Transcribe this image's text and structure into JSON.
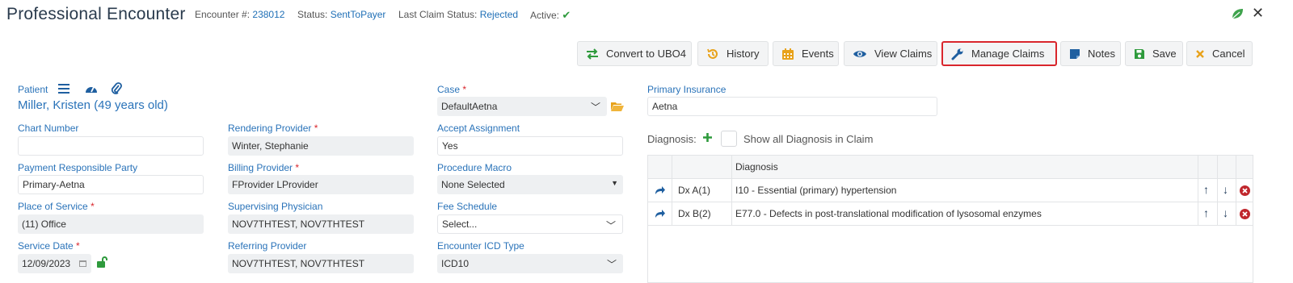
{
  "header": {
    "title": "Professional Encounter",
    "encounter_label": "Encounter #:",
    "encounter_number": "238012",
    "status_label": "Status:",
    "status_value": "SentToPayer",
    "claim_status_label": "Last Claim Status:",
    "claim_status_value": "Rejected",
    "active_label": "Active:",
    "active_icon": "check-icon"
  },
  "toolbar": {
    "convert": "Convert to UBO4",
    "history": "History",
    "events": "Events",
    "view_claims": "View Claims",
    "manage_claims": "Manage Claims",
    "notes": "Notes",
    "save": "Save",
    "cancel": "Cancel"
  },
  "patient": {
    "label": "Patient",
    "name": "Miller, Kristen (49 years old)"
  },
  "fields": {
    "chart_number": {
      "label": "Chart Number",
      "value": ""
    },
    "payment_party": {
      "label": "Payment Responsible Party",
      "value": "Primary-Aetna"
    },
    "place_of_service": {
      "label": "Place of Service",
      "value": "(11) Office"
    },
    "service_date": {
      "label": "Service Date",
      "value": "12/09/2023"
    },
    "rendering_provider": {
      "label": "Rendering Provider",
      "value": "Winter, Stephanie"
    },
    "billing_provider": {
      "label": "Billing Provider",
      "value": "FProvider LProvider"
    },
    "supervising_physician": {
      "label": "Supervising Physician",
      "value": "NOV7THTEST, NOV7THTEST"
    },
    "referring_provider": {
      "label": "Referring Provider",
      "value": "NOV7THTEST, NOV7THTEST"
    },
    "case": {
      "label": "Case",
      "value": "DefaultAetna"
    },
    "accept_assignment": {
      "label": "Accept Assignment",
      "value": "Yes"
    },
    "procedure_macro": {
      "label": "Procedure Macro",
      "value": "None Selected"
    },
    "fee_schedule": {
      "label": "Fee Schedule",
      "value": "Select..."
    },
    "icd_type": {
      "label": "Encounter ICD Type",
      "value": "ICD10"
    },
    "primary_insurance": {
      "label": "Primary Insurance",
      "value": "Aetna"
    }
  },
  "required_mark": "*",
  "diagnosis": {
    "label": "Diagnosis:",
    "show_all_label": "Show all Diagnosis in Claim",
    "column_header": "Diagnosis",
    "rows": [
      {
        "pointer": "Dx A(1)",
        "description": "I10 - Essential (primary) hypertension"
      },
      {
        "pointer": "Dx B(2)",
        "description": "E77.0 - Defects in post-translational modification of lysosomal enzymes"
      }
    ]
  },
  "colors": {
    "accent": "#2a73b9",
    "required": "#d9262c",
    "success": "#2e9a3c",
    "warning": "#e8a21a"
  }
}
